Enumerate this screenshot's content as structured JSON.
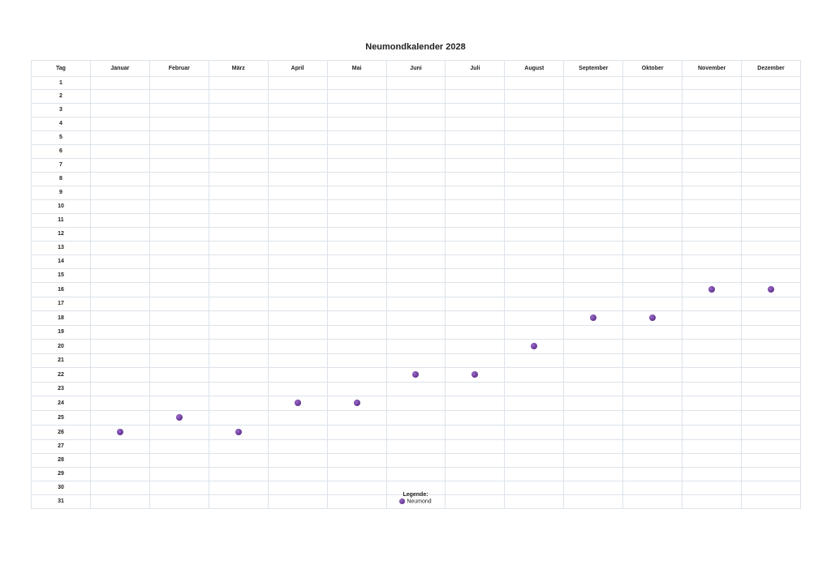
{
  "title": "Neumondkalender 2028",
  "header": {
    "day_label": "Tag",
    "months": [
      "Januar",
      "Februar",
      "März",
      "April",
      "Mai",
      "Juni",
      "Juli",
      "August",
      "September",
      "Oktober",
      "November",
      "Dezember"
    ]
  },
  "days": [
    1,
    2,
    3,
    4,
    5,
    6,
    7,
    8,
    9,
    10,
    11,
    12,
    13,
    14,
    15,
    16,
    17,
    18,
    19,
    20,
    21,
    22,
    23,
    24,
    25,
    26,
    27,
    28,
    29,
    30,
    31
  ],
  "new_moons": [
    {
      "month": "Januar",
      "day": 26
    },
    {
      "month": "Februar",
      "day": 25
    },
    {
      "month": "März",
      "day": 26
    },
    {
      "month": "April",
      "day": 24
    },
    {
      "month": "Mai",
      "day": 24
    },
    {
      "month": "Juni",
      "day": 22
    },
    {
      "month": "Juli",
      "day": 22
    },
    {
      "month": "August",
      "day": 20
    },
    {
      "month": "September",
      "day": 18
    },
    {
      "month": "Oktober",
      "day": 18
    },
    {
      "month": "November",
      "day": 16
    },
    {
      "month": "Dezember",
      "day": 16
    }
  ],
  "legend": {
    "title": "Legende:",
    "items": [
      {
        "label": "Neumond",
        "color": "#6a3a98"
      }
    ]
  }
}
